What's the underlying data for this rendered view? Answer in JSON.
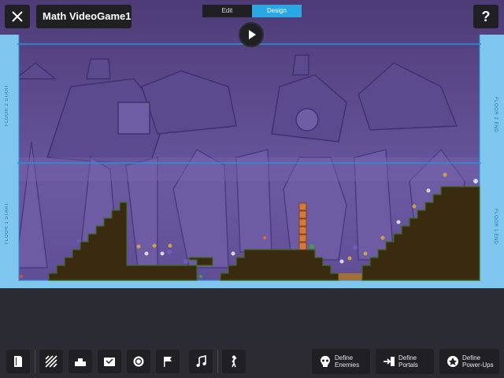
{
  "header": {
    "project_title": "Math VideoGame1",
    "mode_tabs": [
      "Edit",
      "Design"
    ],
    "selected_mode": "Design",
    "help_label": "?"
  },
  "level": {
    "floor2_start": "FLOOR 2 START",
    "floor2_end": "FLOOR 2 END",
    "floor1_start": "FLOOR 1 START",
    "floor1_end": "FLOOR 1 END"
  },
  "toolbar": {
    "tools": [
      "page-icon",
      "pattern-icon",
      "blocks-icon",
      "box-icon",
      "coin-icon",
      "flag-icon",
      "music-icon",
      "character-icon"
    ],
    "define_enemies": "Define\nEnemies",
    "define_portals": "Define\nPortals",
    "define_powerups": "Define\nPower-Ups"
  },
  "colors": {
    "accent": "#2aa8e3",
    "frame": "#7fc7ee",
    "sky": "#5d4a8f",
    "ground": "#3a2a10",
    "grass": "#3f6b22"
  }
}
